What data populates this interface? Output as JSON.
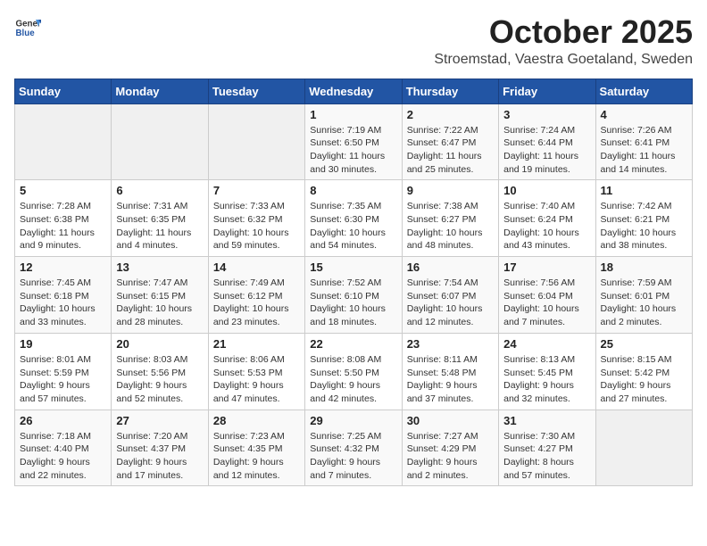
{
  "header": {
    "logo": {
      "general": "General",
      "blue": "Blue"
    },
    "title": "October 2025",
    "location": "Stroemstad, Vaestra Goetaland, Sweden"
  },
  "days_of_week": [
    "Sunday",
    "Monday",
    "Tuesday",
    "Wednesday",
    "Thursday",
    "Friday",
    "Saturday"
  ],
  "weeks": [
    [
      {
        "day": "",
        "info": ""
      },
      {
        "day": "",
        "info": ""
      },
      {
        "day": "",
        "info": ""
      },
      {
        "day": "1",
        "sunrise": "7:19 AM",
        "sunset": "6:50 PM",
        "daylight": "11 hours and 30 minutes."
      },
      {
        "day": "2",
        "sunrise": "7:22 AM",
        "sunset": "6:47 PM",
        "daylight": "11 hours and 25 minutes."
      },
      {
        "day": "3",
        "sunrise": "7:24 AM",
        "sunset": "6:44 PM",
        "daylight": "11 hours and 19 minutes."
      },
      {
        "day": "4",
        "sunrise": "7:26 AM",
        "sunset": "6:41 PM",
        "daylight": "11 hours and 14 minutes."
      }
    ],
    [
      {
        "day": "5",
        "sunrise": "7:28 AM",
        "sunset": "6:38 PM",
        "daylight": "11 hours and 9 minutes."
      },
      {
        "day": "6",
        "sunrise": "7:31 AM",
        "sunset": "6:35 PM",
        "daylight": "11 hours and 4 minutes."
      },
      {
        "day": "7",
        "sunrise": "7:33 AM",
        "sunset": "6:32 PM",
        "daylight": "10 hours and 59 minutes."
      },
      {
        "day": "8",
        "sunrise": "7:35 AM",
        "sunset": "6:30 PM",
        "daylight": "10 hours and 54 minutes."
      },
      {
        "day": "9",
        "sunrise": "7:38 AM",
        "sunset": "6:27 PM",
        "daylight": "10 hours and 48 minutes."
      },
      {
        "day": "10",
        "sunrise": "7:40 AM",
        "sunset": "6:24 PM",
        "daylight": "10 hours and 43 minutes."
      },
      {
        "day": "11",
        "sunrise": "7:42 AM",
        "sunset": "6:21 PM",
        "daylight": "10 hours and 38 minutes."
      }
    ],
    [
      {
        "day": "12",
        "sunrise": "7:45 AM",
        "sunset": "6:18 PM",
        "daylight": "10 hours and 33 minutes."
      },
      {
        "day": "13",
        "sunrise": "7:47 AM",
        "sunset": "6:15 PM",
        "daylight": "10 hours and 28 minutes."
      },
      {
        "day": "14",
        "sunrise": "7:49 AM",
        "sunset": "6:12 PM",
        "daylight": "10 hours and 23 minutes."
      },
      {
        "day": "15",
        "sunrise": "7:52 AM",
        "sunset": "6:10 PM",
        "daylight": "10 hours and 18 minutes."
      },
      {
        "day": "16",
        "sunrise": "7:54 AM",
        "sunset": "6:07 PM",
        "daylight": "10 hours and 12 minutes."
      },
      {
        "day": "17",
        "sunrise": "7:56 AM",
        "sunset": "6:04 PM",
        "daylight": "10 hours and 7 minutes."
      },
      {
        "day": "18",
        "sunrise": "7:59 AM",
        "sunset": "6:01 PM",
        "daylight": "10 hours and 2 minutes."
      }
    ],
    [
      {
        "day": "19",
        "sunrise": "8:01 AM",
        "sunset": "5:59 PM",
        "daylight": "9 hours and 57 minutes."
      },
      {
        "day": "20",
        "sunrise": "8:03 AM",
        "sunset": "5:56 PM",
        "daylight": "9 hours and 52 minutes."
      },
      {
        "day": "21",
        "sunrise": "8:06 AM",
        "sunset": "5:53 PM",
        "daylight": "9 hours and 47 minutes."
      },
      {
        "day": "22",
        "sunrise": "8:08 AM",
        "sunset": "5:50 PM",
        "daylight": "9 hours and 42 minutes."
      },
      {
        "day": "23",
        "sunrise": "8:11 AM",
        "sunset": "5:48 PM",
        "daylight": "9 hours and 37 minutes."
      },
      {
        "day": "24",
        "sunrise": "8:13 AM",
        "sunset": "5:45 PM",
        "daylight": "9 hours and 32 minutes."
      },
      {
        "day": "25",
        "sunrise": "8:15 AM",
        "sunset": "5:42 PM",
        "daylight": "9 hours and 27 minutes."
      }
    ],
    [
      {
        "day": "26",
        "sunrise": "7:18 AM",
        "sunset": "4:40 PM",
        "daylight": "9 hours and 22 minutes."
      },
      {
        "day": "27",
        "sunrise": "7:20 AM",
        "sunset": "4:37 PM",
        "daylight": "9 hours and 17 minutes."
      },
      {
        "day": "28",
        "sunrise": "7:23 AM",
        "sunset": "4:35 PM",
        "daylight": "9 hours and 12 minutes."
      },
      {
        "day": "29",
        "sunrise": "7:25 AM",
        "sunset": "4:32 PM",
        "daylight": "9 hours and 7 minutes."
      },
      {
        "day": "30",
        "sunrise": "7:27 AM",
        "sunset": "4:29 PM",
        "daylight": "9 hours and 2 minutes."
      },
      {
        "day": "31",
        "sunrise": "7:30 AM",
        "sunset": "4:27 PM",
        "daylight": "8 hours and 57 minutes."
      },
      {
        "day": "",
        "info": ""
      }
    ]
  ]
}
